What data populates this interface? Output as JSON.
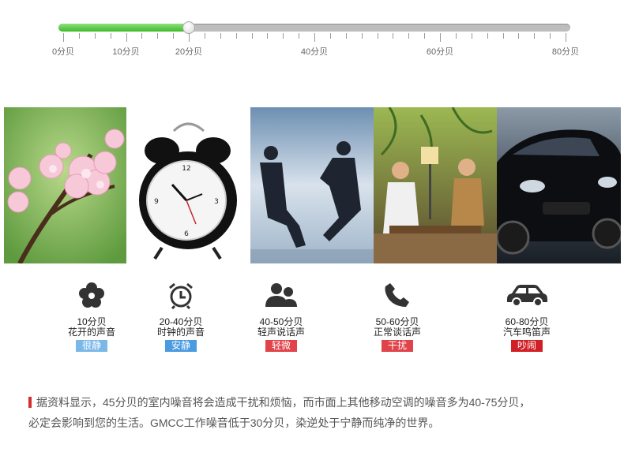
{
  "slider": {
    "value": 20,
    "min": 0,
    "max": 80,
    "ticks": [
      {
        "value": 0,
        "label": "0分贝"
      },
      {
        "value": 20,
        "label": "20分贝"
      },
      {
        "value": 10,
        "label": "10分贝"
      },
      {
        "value": 40,
        "label": "40分贝"
      },
      {
        "value": 60,
        "label": "60分贝"
      },
      {
        "value": 80,
        "label": "80分贝"
      }
    ],
    "colors": {
      "fill": "#3ebb2b",
      "track": "#bdbdbd"
    }
  },
  "photos": [
    {
      "icon": "peach-blossom-photo"
    },
    {
      "icon": "alarm-clock-photo"
    },
    {
      "icon": "business-talk-photo"
    },
    {
      "icon": "cafe-conversation-photo"
    },
    {
      "icon": "black-car-photo"
    }
  ],
  "categories": [
    {
      "icon": "flower-icon",
      "range": "10分贝",
      "desc": "花开的声音",
      "level": "很静",
      "color": "#7ab8e8"
    },
    {
      "icon": "alarm-clock-icon",
      "range": "20-40分贝",
      "desc": "时钟的声音",
      "level": "安静",
      "color": "#4a9be0"
    },
    {
      "icon": "people-icon",
      "range": "40-50分贝",
      "desc": "轻声说话声",
      "level": "轻微",
      "color": "#e0434a"
    },
    {
      "icon": "phone-icon",
      "range": "50-60分贝",
      "desc": "正常谈话声",
      "level": "干扰",
      "color": "#e0434a"
    },
    {
      "icon": "car-icon",
      "range": "60-80分贝",
      "desc": "汽车鸣笛声",
      "level": "吵闹",
      "color": "#d11f26"
    }
  ],
  "footer": {
    "line1": "据资料显示，45分贝的室内噪音将会造成干扰和烦恼，而市面上其他移动空调的噪音多为40-75分贝，",
    "line2": "必定会影响到您的生活。GMCC工作噪音低于30分贝，染逆处于宁静而纯净的世界。"
  }
}
